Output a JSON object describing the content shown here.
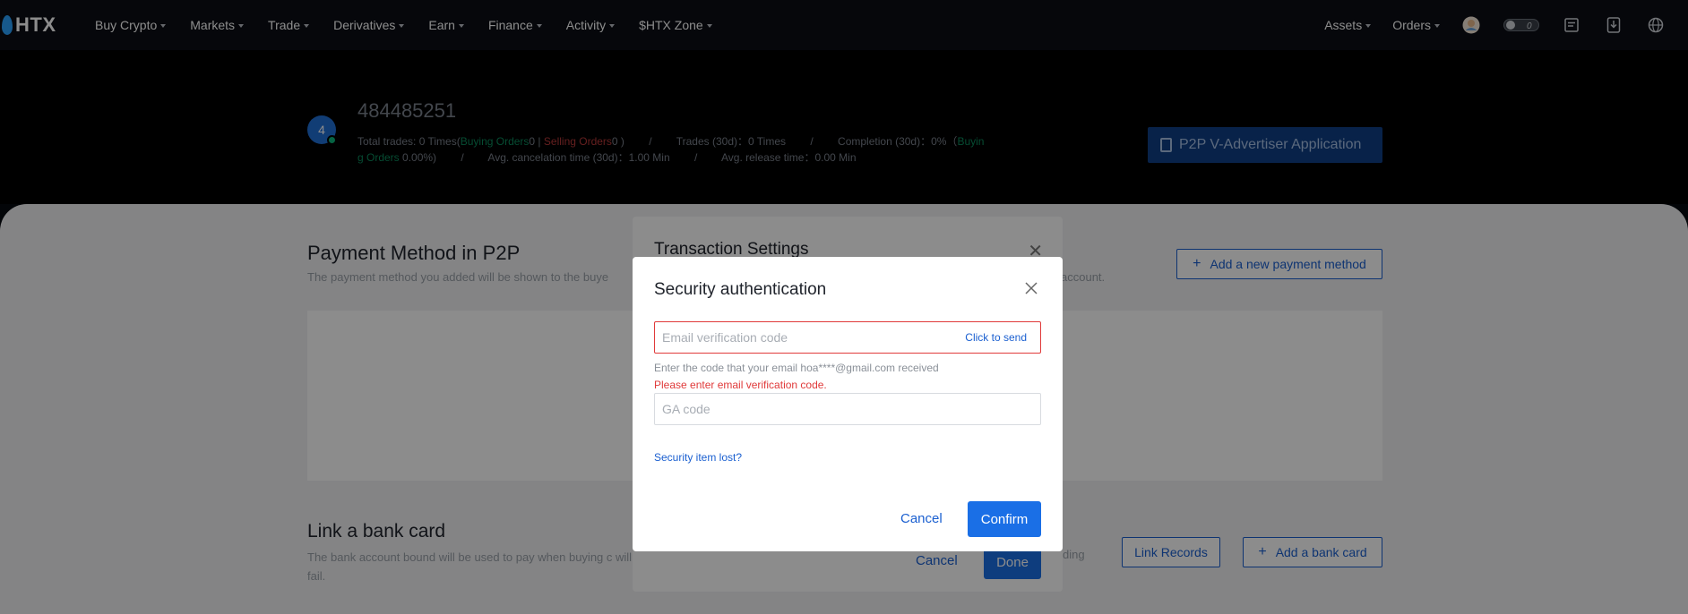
{
  "nav": {
    "logo": "HTX",
    "items": [
      {
        "label": "Buy Crypto"
      },
      {
        "label": "Markets"
      },
      {
        "label": "Trade"
      },
      {
        "label": "Derivatives"
      },
      {
        "label": "Earn"
      },
      {
        "label": "Finance"
      },
      {
        "label": "Activity"
      },
      {
        "label": "$HTX Zone"
      }
    ],
    "right": {
      "assets": "Assets",
      "orders": "Orders",
      "toggle_count": "0"
    }
  },
  "profile": {
    "avatar_letter": "4",
    "uid": "484485251",
    "total_trades_prefix": "Total trades: 0 Times(",
    "buying_orders_label": "Buying Orders",
    "buying_count": "0 |",
    "selling_orders_label": "Selling Orders",
    "selling_count": "0 )",
    "trades_30d": "Trades (30d)：0 Times",
    "completion": "Completion (30d)：0%（",
    "buying_orders_wrap_a": "Buyin",
    "buying_orders_wrap_b": "g Orders",
    "completion_value": " 0.00%)",
    "avg_cancel": "Avg. cancelation time (30d)：1.00 Min",
    "avg_release": "Avg. release time：0.00 Min",
    "slash": "/",
    "advertiser_button": "P2P V-Advertiser Application"
  },
  "payment": {
    "title": "Payment Method in P2P",
    "subtitle": "The payment method you added will be shown to the buye",
    "subtitle_right": "account.",
    "add_button": "Add a new payment method"
  },
  "bank": {
    "title": "Link a bank card",
    "subtitle": "The bank account bound will be used to pay when buying c will fail.",
    "subtitle_right": "ding",
    "link_records": "Link Records",
    "add_button": "Add a bank card"
  },
  "tx_modal": {
    "title": "Transaction Settings",
    "cancel": "Cancel",
    "done": "Done"
  },
  "sec_modal": {
    "title": "Security authentication",
    "email_placeholder": "Email verification code",
    "send_link": "Click to send",
    "email_hint": "Enter the code that your email hoa****@gmail.com received",
    "email_error": "Please enter email verification code.",
    "ga_placeholder": "GA code",
    "lost_link": "Security item lost?",
    "cancel": "Cancel",
    "confirm": "Confirm"
  },
  "colors": {
    "accent": "#1a6fe6",
    "error": "#e03a3a",
    "positive": "#0b8a5c"
  }
}
